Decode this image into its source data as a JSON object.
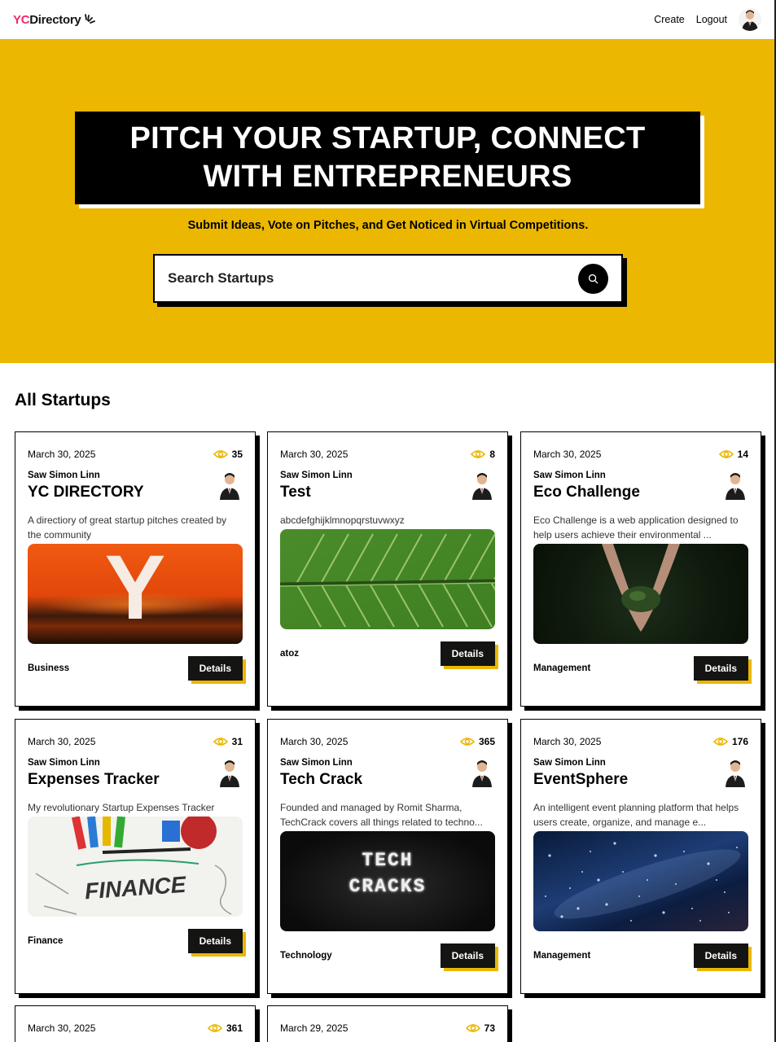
{
  "nav": {
    "logo_yc": "YC",
    "logo_dir": "Directory",
    "create": "Create",
    "logout": "Logout"
  },
  "hero": {
    "heading_line1": "PITCH YOUR STARTUP, CONNECT",
    "heading_line2": "WITH ENTREPRENEURS",
    "subheading": "Submit Ideas, Vote on Pitches, and Get Noticed in Virtual Competitions.",
    "search_placeholder": "Search Startups"
  },
  "colors": {
    "accent": "#EBB700",
    "brand_pink": "#EE2B69",
    "dark": "#141413"
  },
  "section_title": "All Startups",
  "startups": [
    {
      "date": "March 30, 2025",
      "views": "35",
      "author": "Saw Simon Linn",
      "title": "YC DIRECTORY",
      "description": "A directiory of great startup pitches created by the community",
      "category": "Business",
      "details": "Details",
      "image": "yc-orange-logo"
    },
    {
      "date": "March 30, 2025",
      "views": "8",
      "author": "Saw Simon Linn",
      "title": "Test",
      "description": "abcdefghijklmnopqrstuvwxyz",
      "category": "atoz",
      "details": "Details",
      "image": "green-leaf"
    },
    {
      "date": "March 30, 2025",
      "views": "14",
      "author": "Saw Simon Linn",
      "title": "Eco Challenge",
      "description": "Eco Challenge is a web application designed to help users achieve their environmental ...",
      "category": "Management",
      "details": "Details",
      "image": "hands-soil"
    },
    {
      "date": "March 30, 2025",
      "views": "31",
      "author": "Saw Simon Linn",
      "title": "Expenses Tracker",
      "description": "My revolutionary Startup Expenses Tracker",
      "category": "Finance",
      "details": "Details",
      "image": "finance-sketch"
    },
    {
      "date": "March 30, 2025",
      "views": "365",
      "author": "Saw Simon Linn",
      "title": "Tech Crack",
      "description": "Founded and managed by Romit Sharma, TechCrack covers all things related to techno...",
      "category": "Technology",
      "details": "Details",
      "image": "tech-cracks"
    },
    {
      "date": "March 30, 2025",
      "views": "176",
      "author": "Saw Simon Linn",
      "title": "EventSphere",
      "description": "An intelligent event planning platform that helps users create, organize, and manage e...",
      "category": "Management",
      "details": "Details",
      "image": "starry-sky"
    },
    {
      "date": "March 30, 2025",
      "views": "361"
    },
    {
      "date": "March 29, 2025",
      "views": "73"
    }
  ],
  "image_text": {
    "y_letter": "Y",
    "finance": "FINANCE",
    "tech_line1": "TECH",
    "tech_line2": "CRACKS"
  }
}
